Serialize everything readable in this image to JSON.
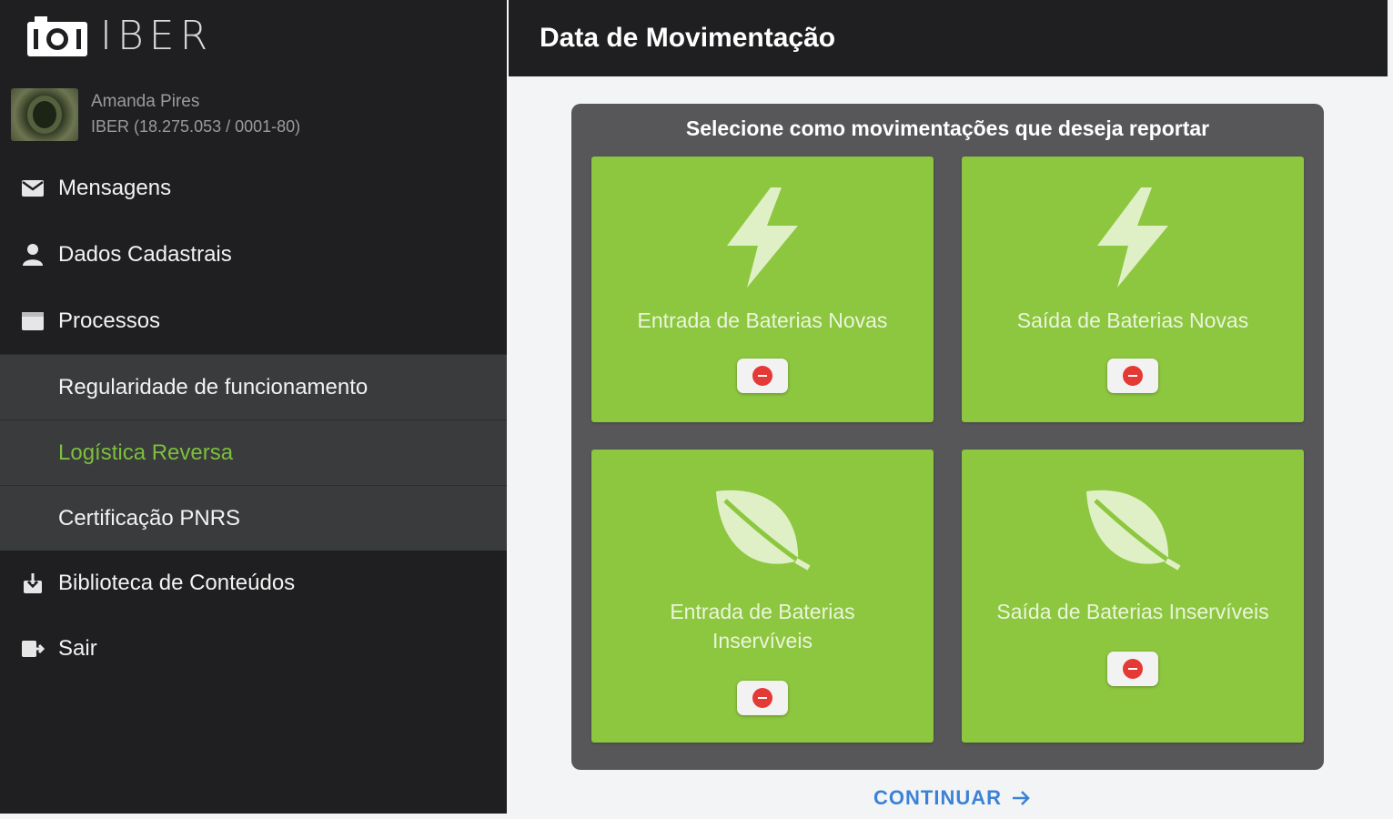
{
  "brand": {
    "logo_text": "IBER"
  },
  "user": {
    "name": "Amanda Pires",
    "org": "IBER (18.275.053 / 0001-80)"
  },
  "sidebar": {
    "items": [
      {
        "label": "Mensagens",
        "icon": "envelope-icon"
      },
      {
        "label": "Dados Cadastrais",
        "icon": "person-icon"
      },
      {
        "label": "Processos",
        "icon": "folder-icon"
      }
    ],
    "subitems": [
      {
        "label": "Regularidade de funcionamento",
        "active": false
      },
      {
        "label": "Logística Reversa",
        "active": true
      },
      {
        "label": "Certificação PNRS",
        "active": false
      }
    ],
    "after_items": [
      {
        "label": "Biblioteca de Conteúdos",
        "icon": "download-icon"
      },
      {
        "label": "Sair",
        "icon": "logout-icon"
      }
    ],
    "active_color": "#7cbf3c"
  },
  "header": {
    "title": "Data de Movimentação"
  },
  "panel": {
    "title": "Selecione como movimentações que deseja reportar",
    "cards": [
      {
        "label": "Entrada de Baterias Novas",
        "icon": "lightning-icon"
      },
      {
        "label": "Saída de Baterias Novas",
        "icon": "lightning-icon"
      },
      {
        "label_line1": "Entrada de Baterias",
        "label_line2": "Inservíveis",
        "icon": "leaf-icon"
      },
      {
        "label": "Saída de Baterias Inservíveis",
        "icon": "leaf-icon"
      }
    ],
    "card_color": "#8dc63f"
  },
  "footer": {
    "continue_label": "CONTINUAR"
  }
}
